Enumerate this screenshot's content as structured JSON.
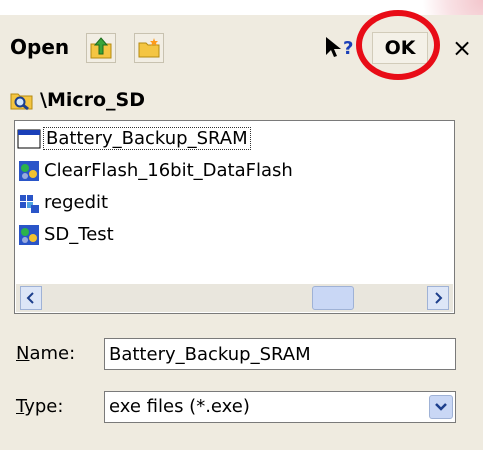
{
  "toolbar": {
    "title": "Open",
    "up_icon": "up-folder-icon",
    "new_folder_icon": "new-folder-icon",
    "help_icon": "whats-this-help-icon",
    "ok_label": "OK",
    "close_label": "×"
  },
  "path": {
    "icon": "folder-search-icon",
    "text": "\\Micro_SD"
  },
  "files": [
    {
      "name": "Battery_Backup_SRAM",
      "icon": "window-app-icon",
      "selected": true
    },
    {
      "name": "ClearFlash_16bit_DataFlash",
      "icon": "exe-app-icon",
      "selected": false
    },
    {
      "name": "regedit",
      "icon": "regedit-app-icon",
      "selected": false
    },
    {
      "name": "SD_Test",
      "icon": "exe-app-icon",
      "selected": false
    }
  ],
  "form": {
    "name_label_accel": "N",
    "name_label_rest": "ame:",
    "name_value": "Battery_Backup_SRAM",
    "type_label_accel": "T",
    "type_label_rest": "ype:",
    "type_value": "exe files (*.exe)"
  },
  "colors": {
    "background": "#efebe0",
    "highlight_circle": "#e80c17"
  }
}
